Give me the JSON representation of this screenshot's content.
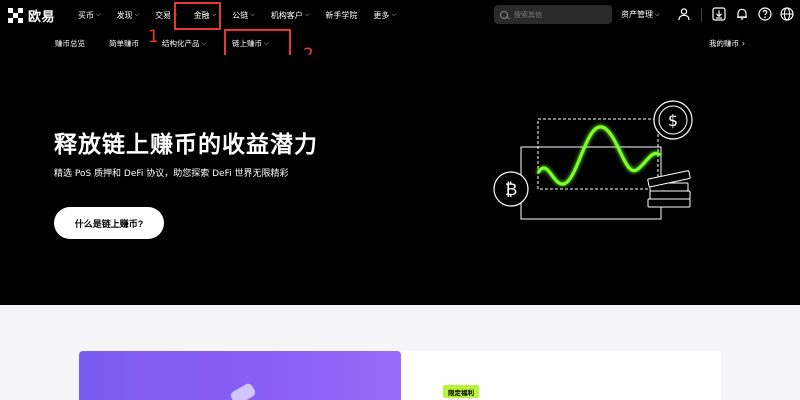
{
  "app": {
    "logo_text": "欧易"
  },
  "topnav": {
    "items": [
      {
        "label": "买币",
        "has_chevron": true
      },
      {
        "label": "发现",
        "has_chevron": true
      },
      {
        "label": "交易",
        "has_chevron": true
      },
      {
        "label": "金融",
        "has_chevron": true
      },
      {
        "label": "公链",
        "has_chevron": true
      },
      {
        "label": "机构客户",
        "has_chevron": true
      },
      {
        "label": "新手学院",
        "has_chevron": false
      },
      {
        "label": "更多",
        "has_chevron": true
      }
    ],
    "search_placeholder": "搜索其他",
    "assets_label": "资产管理",
    "icons": [
      "user-icon",
      "download-icon",
      "bell-icon",
      "help-icon",
      "globe-icon"
    ]
  },
  "subnav": {
    "items": [
      {
        "label": "赚币总览",
        "has_chevron": false
      },
      {
        "label": "简单赚币",
        "has_chevron": false
      },
      {
        "label": "结构化产品",
        "has_chevron": true
      },
      {
        "label": "链上赚币",
        "has_chevron": true
      }
    ],
    "right_label": "我的赚币",
    "right_chevron": "›"
  },
  "annotations": [
    {
      "number": "1",
      "color": "#e53935"
    },
    {
      "number": "2",
      "color": "#e53935"
    }
  ],
  "hero": {
    "title": "释放链上赚币的收益潜力",
    "subtitle": "精选 PoS 质押和 DeFi 协议，助您探索 DeFi 世界无限精彩",
    "cta_label": "什么是链上赚币?",
    "accent_color": "#7cff2a"
  },
  "lower": {
    "badge_label": "限定福利",
    "badge_color": "#b9f23f",
    "card_color": "#7b5bf0"
  }
}
